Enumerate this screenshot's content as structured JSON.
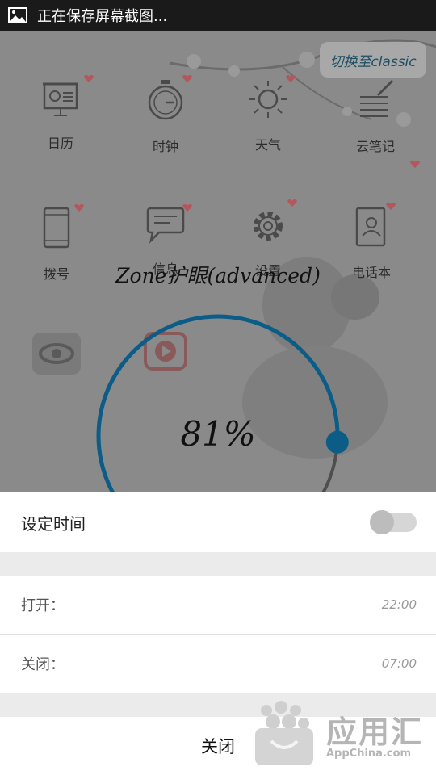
{
  "status_bar": {
    "text": "正在保存屏幕截图..."
  },
  "launcher": {
    "switch_label": "切换至classic",
    "apps": [
      {
        "label": "日历",
        "icon": "calendar-icon"
      },
      {
        "label": "时钟",
        "icon": "clock-icon"
      },
      {
        "label": "天气",
        "icon": "weather-icon"
      },
      {
        "label": "云笔记",
        "icon": "notes-icon"
      },
      {
        "label": "拨号",
        "icon": "phone-icon"
      },
      {
        "label": "信息",
        "icon": "message-icon"
      },
      {
        "label": "设置",
        "icon": "settings-icon"
      },
      {
        "label": "电话本",
        "icon": "contacts-icon"
      }
    ]
  },
  "eye_care": {
    "title": "Zone护眼(advanced)",
    "percent_label": "81%",
    "percent": 81,
    "accent_color": "#0b5c86"
  },
  "sheet": {
    "timer_label": "设定时间",
    "timer_enabled": false,
    "on_label": "打开：",
    "on_time": "22:00",
    "off_label": "关闭：",
    "off_time": "07:00",
    "close_label": "关闭"
  },
  "watermark": {
    "title": "应用汇",
    "url": "AppChina.com"
  }
}
